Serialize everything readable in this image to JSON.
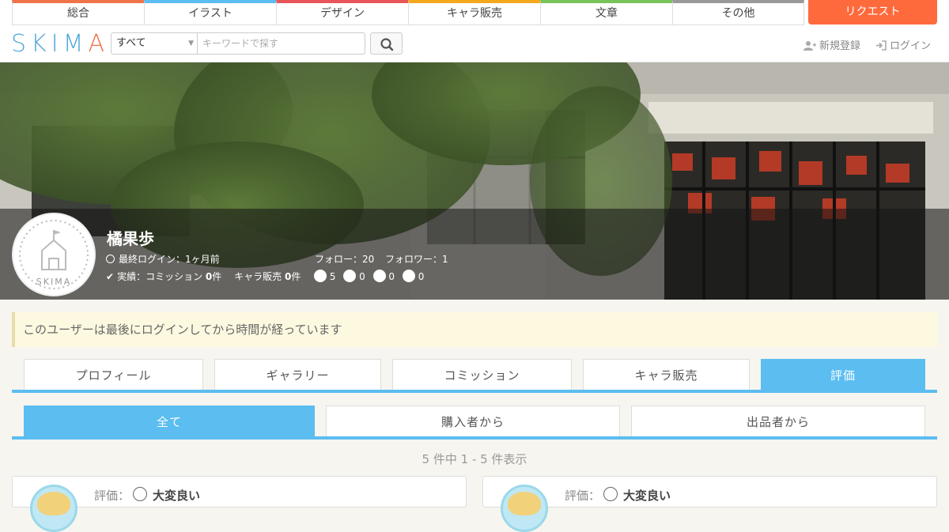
{
  "topnav": {
    "categories": [
      "総合",
      "イラスト",
      "デザイン",
      "キャラ販売",
      "文章",
      "その他"
    ],
    "category_colors": [
      "#f0734a",
      "#5bbdf0",
      "#e8565b",
      "#f4a81c",
      "#7ac25a",
      "#999999"
    ],
    "request_label": "リクエスト"
  },
  "header": {
    "logo_letters": [
      "S",
      "K",
      "I",
      "M",
      "A"
    ],
    "logo_colors": [
      "#4fa8d8",
      "#4fa8d8",
      "#4fa8d8",
      "#4fa8d8",
      "#f0734a"
    ],
    "search_scope": "すべて",
    "search_placeholder": "キーワードで探す",
    "register_label": "新規登録",
    "login_label": "ログイン"
  },
  "profile": {
    "name": "橘果歩",
    "last_login": "最終ログイン：1ヶ月前",
    "follow": "フォロー：20",
    "follower": "フォロワー：1",
    "achievements_prefix": "実績：コミッション",
    "commission_count": "0",
    "unit": "件",
    "chara_label": "キャラ販売",
    "chara_count": "0",
    "ratings": [
      "5",
      "0",
      "0",
      "0"
    ],
    "avatar_text": "SKIMA"
  },
  "notice": "このユーザーは最後にログインしてから時間が経っています",
  "tabs": [
    "プロフィール",
    "ギャラリー",
    "コミッション",
    "キャラ販売",
    "評価"
  ],
  "subtabs": [
    "全て",
    "購入者から",
    "出品者から"
  ],
  "count_text": "5 件中 1 - 5 件表示",
  "reviews": [
    {
      "label": "評価：",
      "value": "大変良い"
    },
    {
      "label": "評価：",
      "value": "大変良い"
    }
  ]
}
